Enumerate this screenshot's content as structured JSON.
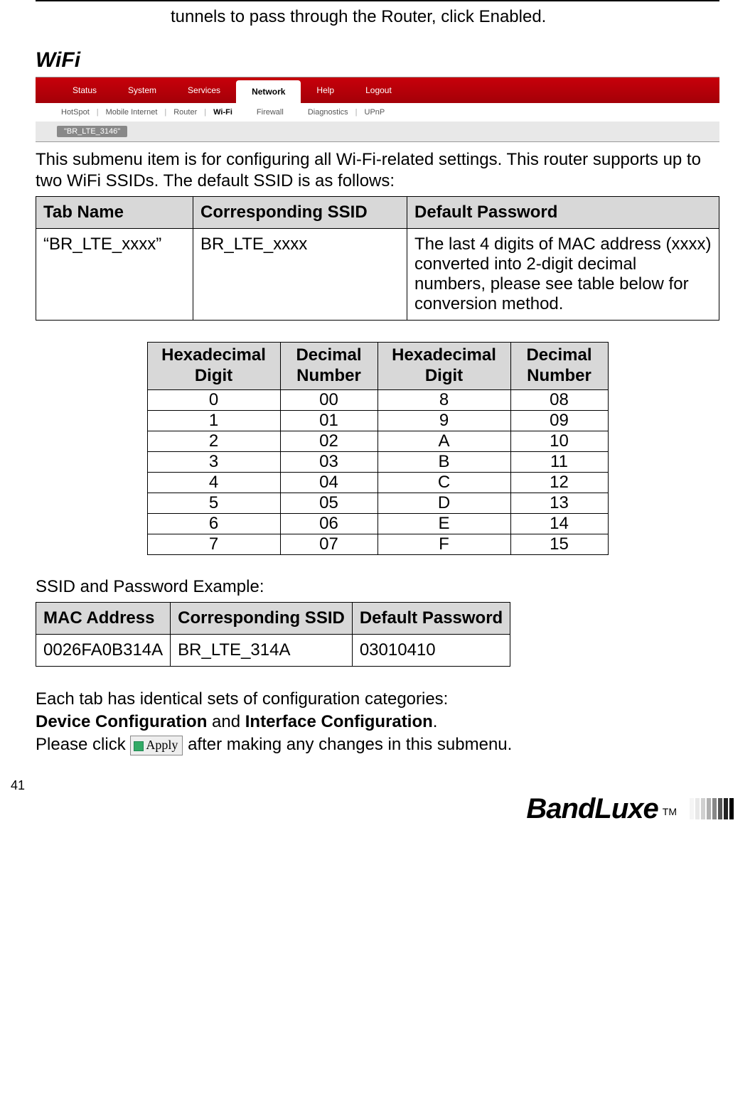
{
  "intro_line": "tunnels to pass through the Router, click Enabled.",
  "section_heading": "WiFi",
  "nav": {
    "top": [
      "Status",
      "System",
      "Services",
      "Network",
      "Help",
      "Logout"
    ],
    "top_active_index": 3,
    "sub": [
      "HotSpot",
      "Mobile Internet",
      "Router",
      "Wi-Fi",
      "Firewall",
      "Diagnostics",
      "UPnP"
    ],
    "sub_active_index": 3,
    "chip": "\"BR_LTE_3146\""
  },
  "body_text": "This submenu item is for configuring all Wi-Fi-related settings. This router supports up to two WiFi SSIDs. The default SSID is as follows:",
  "ssid_table": {
    "headers": [
      "Tab Name",
      "Corresponding SSID",
      "Default Password"
    ],
    "row": {
      "tab_name": "“BR_LTE_xxxx”",
      "ssid": "BR_LTE_xxxx",
      "password": "The last 4 digits of MAC address (xxxx) converted into 2-digit decimal numbers, please see table below for conversion method."
    }
  },
  "hex_table": {
    "headers": [
      "Hexadecimal Digit",
      "Decimal Number",
      "Hexadecimal Digit",
      "Decimal Number"
    ],
    "rows": [
      {
        "h1": "0",
        "d1": "00",
        "h2": "8",
        "d2": "08"
      },
      {
        "h1": "1",
        "d1": "01",
        "h2": "9",
        "d2": "09"
      },
      {
        "h1": "2",
        "d1": "02",
        "h2": "A",
        "d2": "10"
      },
      {
        "h1": "3",
        "d1": "03",
        "h2": "B",
        "d2": "11"
      },
      {
        "h1": "4",
        "d1": "04",
        "h2": "C",
        "d2": "12"
      },
      {
        "h1": "5",
        "d1": "05",
        "h2": "D",
        "d2": "13"
      },
      {
        "h1": "6",
        "d1": "06",
        "h2": "E",
        "d2": "14"
      },
      {
        "h1": "7",
        "d1": "07",
        "h2": "F",
        "d2": "15"
      }
    ]
  },
  "example_heading": "SSID and Password Example:",
  "example_table": {
    "headers": [
      "MAC Address",
      "Corresponding SSID",
      "Default Password"
    ],
    "row": {
      "mac": "0026FA0B314A",
      "ssid": "BR_LTE_314A",
      "pwd": "03010410"
    }
  },
  "config_para": {
    "line1_pre": "Each tab has identical sets of configuration categories:",
    "bold1": "Device Configuration",
    "mid": " and ",
    "bold2": "Interface Configuration",
    "line3_pre": "Please click ",
    "apply_label": "Apply",
    "line3_post": " after making any changes in this submenu."
  },
  "page_number": "41",
  "brand": "BandLuxe",
  "tm": "TM",
  "stripe_colors": [
    "#f5f5f5",
    "#e8e8e8",
    "#d0d0d0",
    "#b0b0b0",
    "#888",
    "#555",
    "#222",
    "#000"
  ]
}
